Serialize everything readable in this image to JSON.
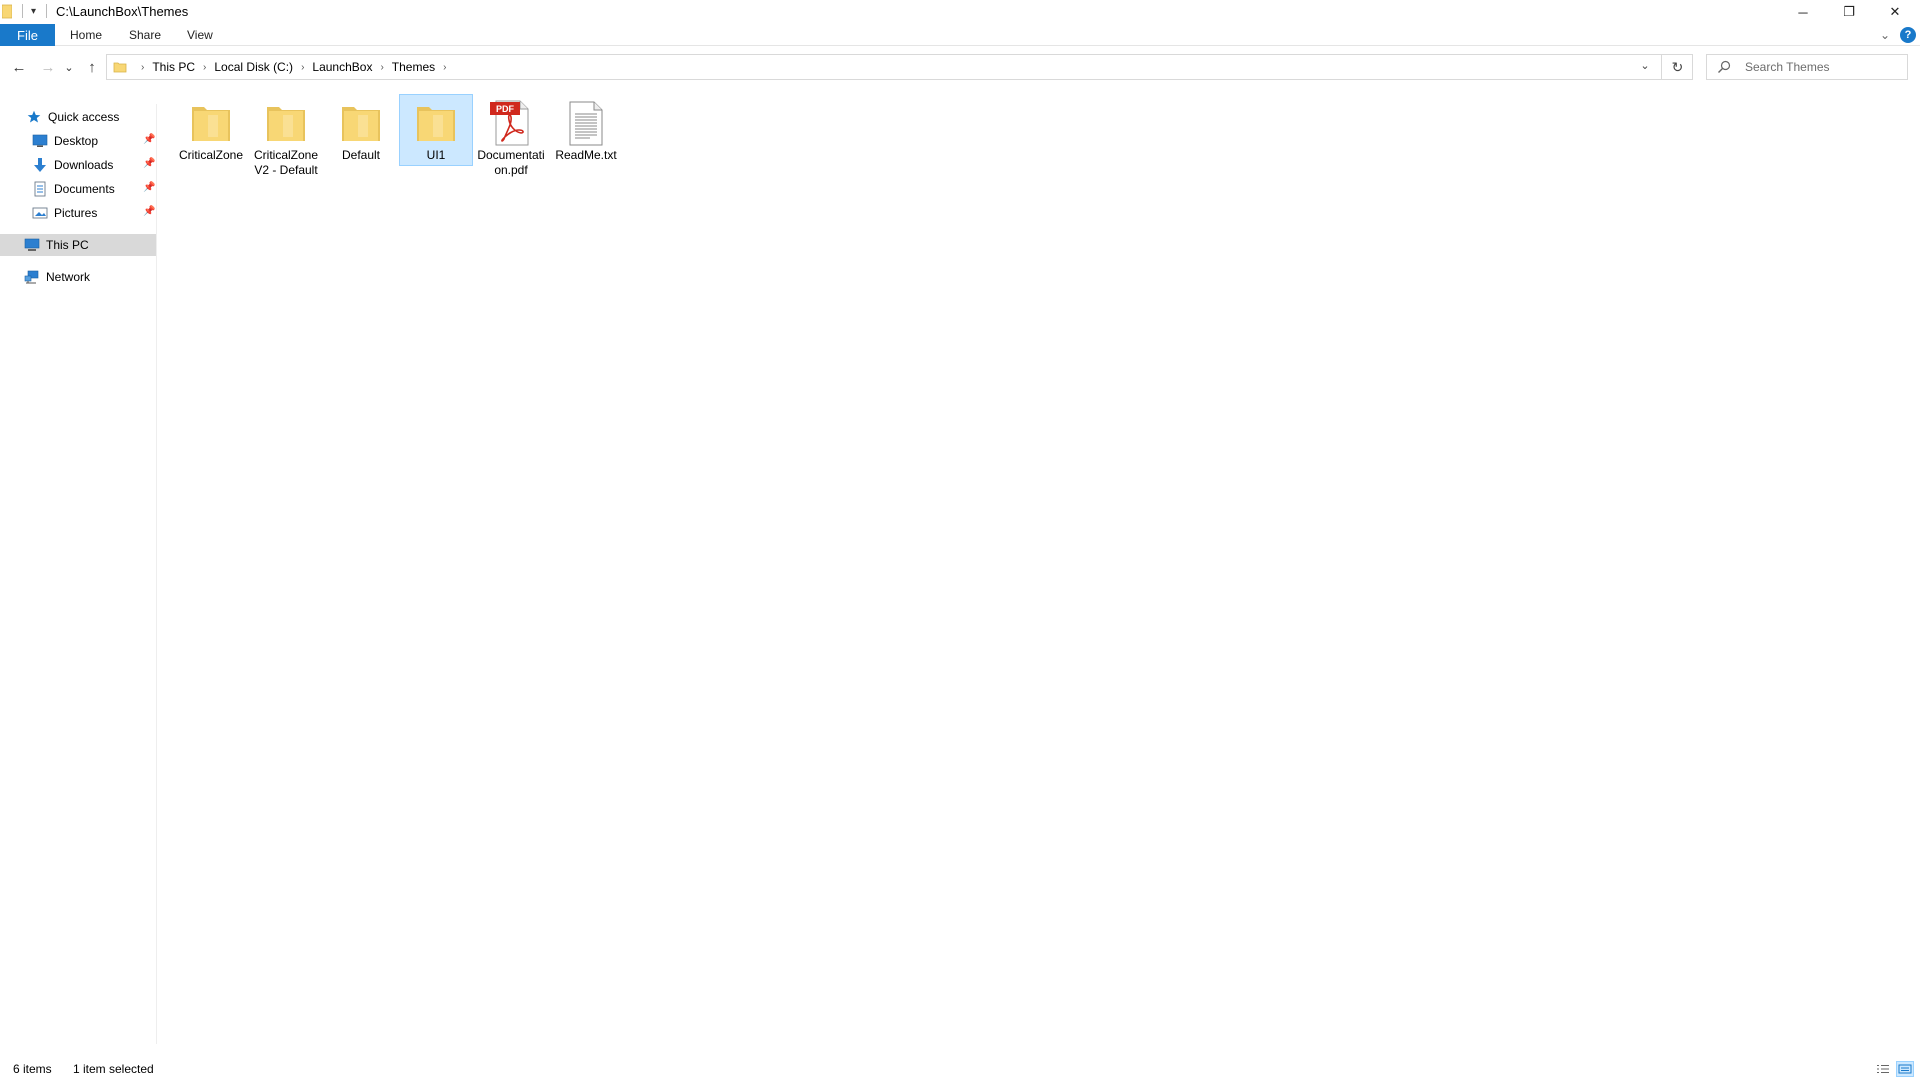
{
  "window": {
    "title": "C:\\LaunchBox\\Themes",
    "controls": {
      "minimize": "─",
      "restore": "❐",
      "close": "✕"
    }
  },
  "ribbon": {
    "tabs": [
      {
        "label": "File"
      },
      {
        "label": "Home"
      },
      {
        "label": "Share"
      },
      {
        "label": "View"
      }
    ],
    "help": "?"
  },
  "nav": {
    "back": "←",
    "forward": "→",
    "recent": "⌄",
    "up": "↑"
  },
  "address": {
    "breadcrumbs": [
      "This PC",
      "Local Disk (C:)",
      "LaunchBox",
      "Themes"
    ],
    "refresh": "↻"
  },
  "search": {
    "placeholder": "Search Themes"
  },
  "sidebar": {
    "quick_access": {
      "label": "Quick access"
    },
    "pinned": [
      {
        "label": "Desktop",
        "icon": "desktop-icon"
      },
      {
        "label": "Downloads",
        "icon": "downloads-icon"
      },
      {
        "label": "Documents",
        "icon": "documents-icon"
      },
      {
        "label": "Pictures",
        "icon": "pictures-icon"
      }
    ],
    "this_pc": {
      "label": "This PC"
    },
    "network": {
      "label": "Network"
    }
  },
  "files": [
    {
      "name": "CriticalZone",
      "type": "folder"
    },
    {
      "name": "CriticalZoneV2 - Default",
      "type": "folder"
    },
    {
      "name": "Default",
      "type": "folder"
    },
    {
      "name": "UI1",
      "type": "folder",
      "selected": true
    },
    {
      "name": "Documentation.pdf",
      "type": "pdf"
    },
    {
      "name": "ReadMe.txt",
      "type": "txt"
    }
  ],
  "pdf_badge": "PDF",
  "status": {
    "item_count": "6 items",
    "selection": "1 item selected"
  },
  "colors": {
    "accent": "#1979ca",
    "selection_bg": "#cce8ff",
    "folder": "#f8d775",
    "pdf_red": "#d0281d"
  }
}
